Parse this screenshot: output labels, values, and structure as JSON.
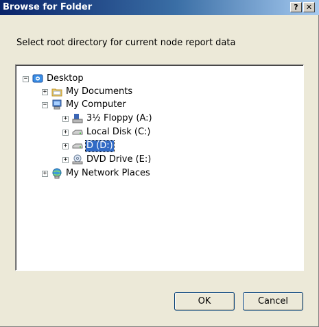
{
  "window": {
    "title": "Browse for Folder",
    "help_glyph": "?",
    "close_glyph": "✕"
  },
  "prompt": "Select root directory for current node report data",
  "tree": [
    {
      "label": "Desktop",
      "icon": "desktop-icon",
      "expander": "−",
      "selected": false
    },
    {
      "label": "My Documents",
      "icon": "folder-icon",
      "expander": "+",
      "selected": false
    },
    {
      "label": "My Computer",
      "icon": "computer-icon",
      "expander": "−",
      "selected": false
    },
    {
      "label": "3½ Floppy (A:)",
      "icon": "floppy-icon",
      "expander": "+",
      "selected": false
    },
    {
      "label": "Local Disk (C:)",
      "icon": "drive-icon",
      "expander": "+",
      "selected": false
    },
    {
      "label": "D (D:)",
      "icon": "drive-icon",
      "expander": "+",
      "selected": true
    },
    {
      "label": "DVD Drive (E:)",
      "icon": "dvd-icon",
      "expander": "+",
      "selected": false
    },
    {
      "label": "My Network Places",
      "icon": "network-icon",
      "expander": "+",
      "selected": false
    }
  ],
  "buttons": {
    "ok": "OK",
    "cancel": "Cancel"
  },
  "colors": {
    "titlebar_start": "#0a246a",
    "selection": "#316ac5",
    "dialog_bg": "#ece9d8"
  }
}
